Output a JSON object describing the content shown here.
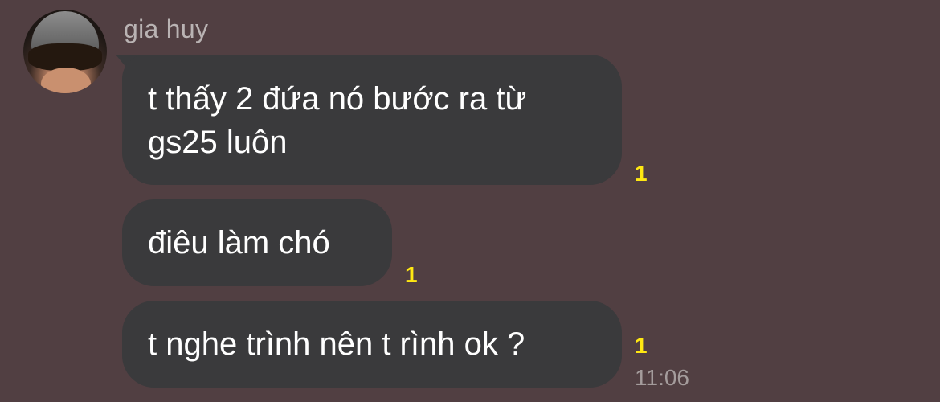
{
  "sender": {
    "name": "gia huy"
  },
  "messages": [
    {
      "text": "t thấy 2 đứa nó bước ra từ gs25 luôn",
      "unread": "1"
    },
    {
      "text": "điêu làm chó",
      "unread": "1"
    },
    {
      "text": "t nghe trình nên t rình ok ?",
      "unread": "1",
      "time": "11:06"
    }
  ],
  "colors": {
    "background": "#513f42",
    "bubble": "#3a3a3c",
    "unread": "#ffe812",
    "text": "#ffffff",
    "muted": "#a49c9c"
  }
}
